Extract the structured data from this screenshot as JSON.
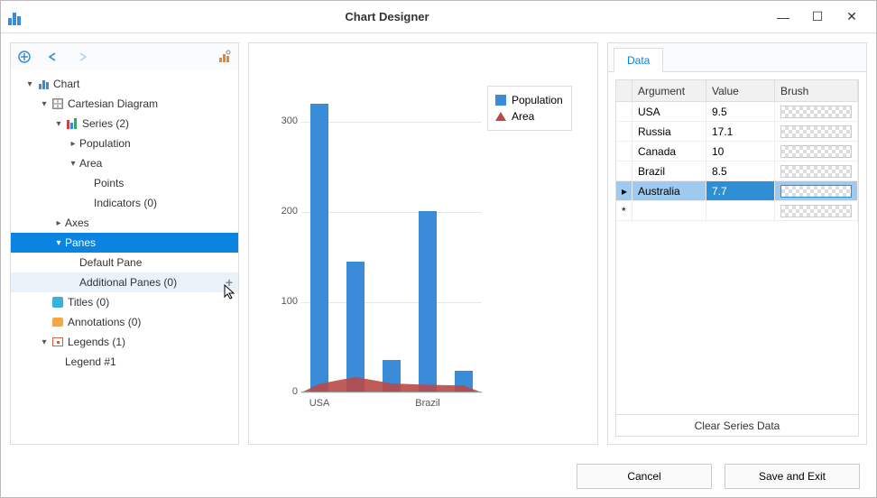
{
  "window": {
    "title": "Chart Designer"
  },
  "tree": {
    "root": "Chart",
    "cartesian": "Cartesian Diagram",
    "series": "Series (2)",
    "series_pop": "Population",
    "series_area": "Area",
    "points": "Points",
    "indicators": "Indicators (0)",
    "axes": "Axes",
    "panes": "Panes",
    "default_pane": "Default Pane",
    "add_panes": "Additional Panes (0)",
    "titles": "Titles (0)",
    "annotations": "Annotations (0)",
    "legends": "Legends (1)",
    "legend1": "Legend #1"
  },
  "chart_data": {
    "type": "bar",
    "categories": [
      "USA",
      "Russia",
      "Canada",
      "Brazil",
      "Australia"
    ],
    "x_tick_labels": [
      "USA",
      "Brazil"
    ],
    "series": [
      {
        "name": "Population",
        "type": "bar",
        "color": "#3a8cd8",
        "values": [
          320,
          145,
          36,
          201,
          24
        ]
      },
      {
        "name": "Area",
        "type": "area",
        "color": "#b84a48",
        "values": [
          9.5,
          17.1,
          10,
          8.5,
          7.7
        ]
      }
    ],
    "ylim": [
      0,
      340
    ],
    "yticks": [
      0,
      100,
      200,
      300
    ],
    "legend": [
      "Population",
      "Area"
    ]
  },
  "data_tab": {
    "label": "Data",
    "columns": {
      "argument": "Argument",
      "value": "Value",
      "brush": "Brush"
    },
    "rows": [
      {
        "argument": "USA",
        "value": "9.5"
      },
      {
        "argument": "Russia",
        "value": "17.1"
      },
      {
        "argument": "Canada",
        "value": "10"
      },
      {
        "argument": "Brazil",
        "value": "8.5"
      },
      {
        "argument": "Australia",
        "value": "7.7"
      }
    ],
    "clear": "Clear Series Data"
  },
  "buttons": {
    "cancel": "Cancel",
    "save": "Save and Exit"
  }
}
